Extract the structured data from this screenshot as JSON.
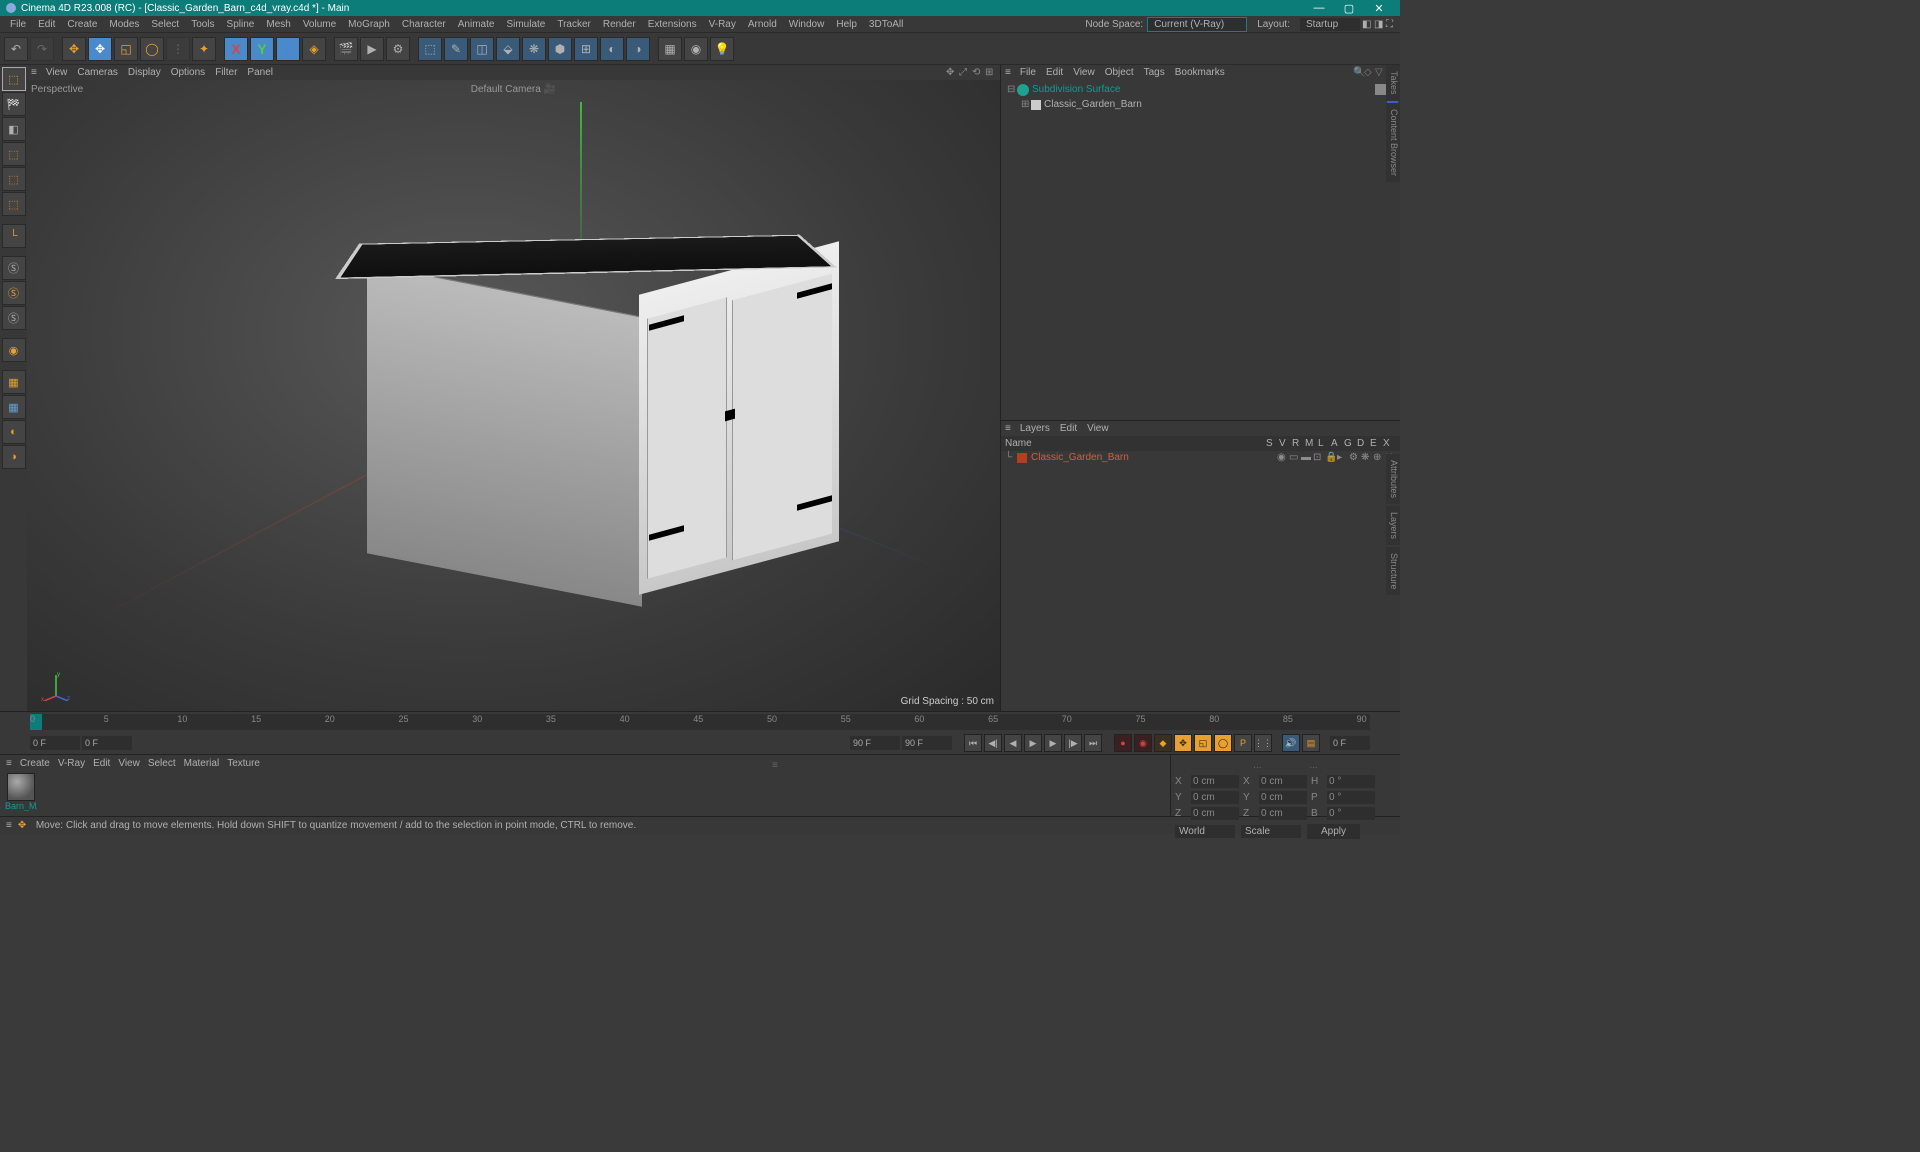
{
  "title": "Cinema 4D R23.008 (RC) - [Classic_Garden_Barn_c4d_vray.c4d *] - Main",
  "menubar": [
    "File",
    "Edit",
    "Create",
    "Modes",
    "Select",
    "Tools",
    "Spline",
    "Mesh",
    "Volume",
    "MoGraph",
    "Character",
    "Animate",
    "Simulate",
    "Tracker",
    "Render",
    "Extensions",
    "V-Ray",
    "Arnold",
    "Window",
    "Help",
    "3DToAll"
  ],
  "nodeSpace": {
    "label": "Node Space:",
    "value": "Current (V-Ray)"
  },
  "layout": {
    "label": "Layout:",
    "value": "Startup"
  },
  "viewport": {
    "menu": [
      "View",
      "Cameras",
      "Display",
      "Options",
      "Filter",
      "Panel"
    ],
    "labelTL": "Perspective",
    "labelTC": "Default Camera",
    "labelBR": "Grid Spacing : 50 cm"
  },
  "objects": {
    "menu": [
      "File",
      "Edit",
      "View",
      "Object",
      "Tags",
      "Bookmarks"
    ],
    "tree": [
      {
        "name": "Subdivision Surface",
        "indent": 0,
        "color": "#0d9d9a",
        "iconColor": "#20a090",
        "hasChild": true
      },
      {
        "name": "Classic_Garden_Barn",
        "indent": 1,
        "color": "#b0b0b0",
        "iconColor": "#4060c0",
        "hasChild": true
      }
    ]
  },
  "layers": {
    "menu": [
      "Layers",
      "Edit",
      "View"
    ],
    "header": {
      "name": "Name",
      "cols": [
        "S",
        "V",
        "R",
        "M",
        "L",
        "A",
        "G",
        "D",
        "E",
        "X"
      ]
    },
    "rows": [
      {
        "name": "Classic_Garden_Barn",
        "color": "#b04020"
      }
    ]
  },
  "rightTabs": [
    "Takes",
    "Content Browser",
    "Attributes",
    "Layers",
    "Structure"
  ],
  "timeline": {
    "ticks": [
      0,
      5,
      10,
      15,
      20,
      25,
      30,
      35,
      40,
      45,
      50,
      55,
      60,
      65,
      70,
      75,
      80,
      85,
      90
    ],
    "startF": "0 F",
    "curF": "0 F",
    "prevEnd": "90 F",
    "endF": "90 F"
  },
  "materials": {
    "menu": [
      "Create",
      "V-Ray",
      "Edit",
      "View",
      "Select",
      "Material",
      "Texture"
    ],
    "items": [
      {
        "name": "Barn_MA"
      }
    ]
  },
  "attrs": {
    "dash": "...",
    "rows": [
      {
        "a": "X",
        "av": "0 cm",
        "b": "X",
        "bv": "0 cm",
        "c": "H",
        "cv": "0 °"
      },
      {
        "a": "Y",
        "av": "0 cm",
        "b": "Y",
        "bv": "0 cm",
        "c": "P",
        "cv": "0 °"
      },
      {
        "a": "Z",
        "av": "0 cm",
        "b": "Z",
        "bv": "0 cm",
        "c": "B",
        "cv": "0 °"
      }
    ],
    "drop1": "World",
    "drop2": "Scale",
    "apply": "Apply"
  },
  "status": "Move: Click and drag to move elements. Hold down SHIFT to quantize movement / add to the selection in point mode, CTRL to remove."
}
